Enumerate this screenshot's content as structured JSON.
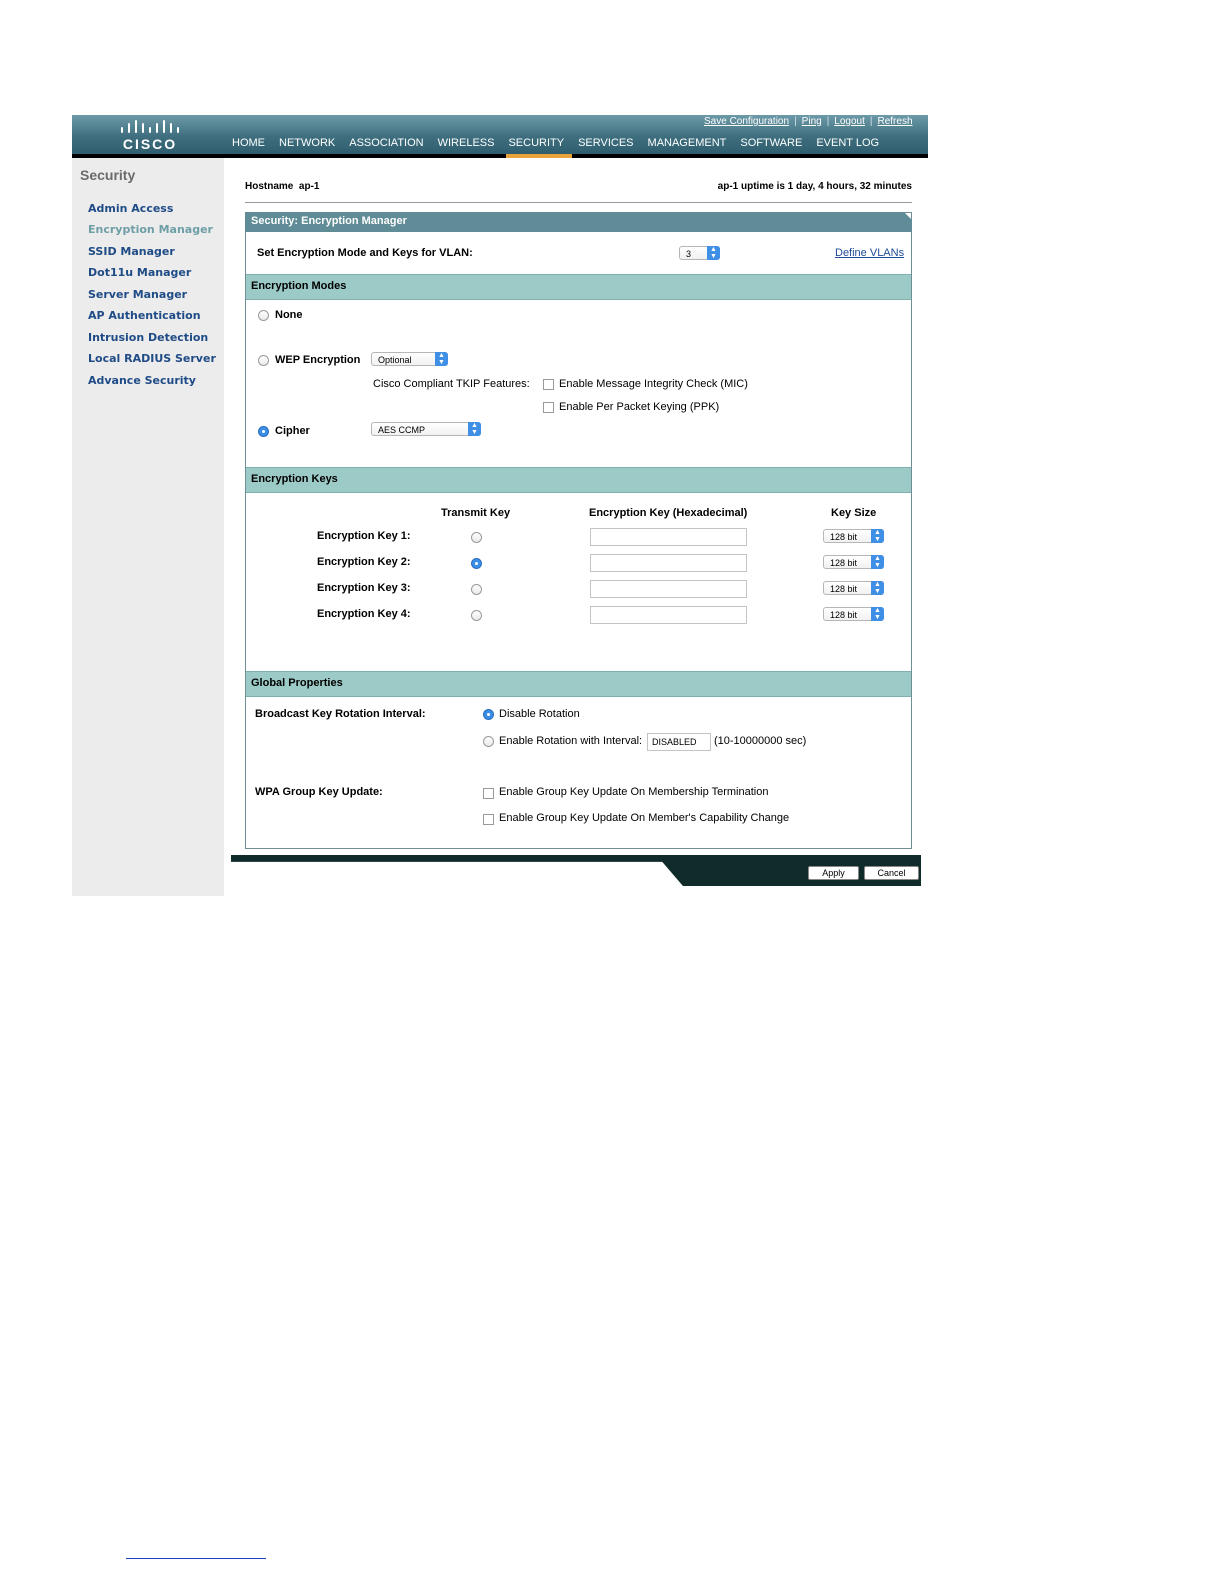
{
  "header": {
    "logo_text": "CISCO",
    "top_links": [
      "Save Configuration",
      "Ping",
      "Logout",
      "Refresh"
    ],
    "nav": [
      "HOME",
      "NETWORK",
      "ASSOCIATION",
      "WIRELESS",
      "SECURITY",
      "SERVICES",
      "MANAGEMENT",
      "SOFTWARE",
      "EVENT LOG"
    ],
    "active_nav": "SECURITY"
  },
  "sidebar": {
    "title": "Security",
    "items": [
      "Admin Access",
      "Encryption Manager",
      "SSID Manager",
      "Dot11u Manager",
      "Server Manager",
      "AP Authentication",
      "Intrusion Detection",
      "Local RADIUS Server",
      "Advance Security"
    ],
    "current": "Encryption Manager"
  },
  "status": {
    "hostname": "Hostname  ap-1",
    "uptime": "ap-1 uptime is 1 day, 4 hours, 32 minutes"
  },
  "panel": {
    "title": "Security: Encryption Manager",
    "vlan_label": "Set Encryption Mode and Keys for VLAN:",
    "vlan_value": "3",
    "define_vlans": "Define VLANs"
  },
  "modes": {
    "title": "Encryption Modes",
    "none": "None",
    "wep": "WEP Encryption",
    "wep_option": "Optional",
    "tkip_label": "Cisco Compliant TKIP Features:",
    "mic": "Enable Message Integrity Check (MIC)",
    "ppk": "Enable Per Packet Keying (PPK)",
    "cipher": "Cipher",
    "cipher_option": "AES CCMP",
    "selected": "Cipher"
  },
  "keys": {
    "title": "Encryption Keys",
    "col_transmit": "Transmit Key",
    "col_key": "Encryption Key (Hexadecimal)",
    "col_size": "Key Size",
    "rows": [
      {
        "label": "Encryption Key 1:",
        "size": "128 bit",
        "transmit": false
      },
      {
        "label": "Encryption Key 2:",
        "size": "128 bit",
        "transmit": true
      },
      {
        "label": "Encryption Key 3:",
        "size": "128 bit",
        "transmit": false
      },
      {
        "label": "Encryption Key 4:",
        "size": "128 bit",
        "transmit": false
      }
    ]
  },
  "global": {
    "title": "Global Properties",
    "broadcast_label": "Broadcast Key Rotation Interval:",
    "disable_rotation": "Disable Rotation",
    "enable_rotation": "Enable Rotation with Interval:",
    "interval_value": "DISABLED",
    "interval_range": "(10-10000000 sec)",
    "wpa_label": "WPA Group Key Update:",
    "membership": "Enable Group Key Update On Membership Termination",
    "capability": "Enable Group Key Update On Member's Capability Change"
  },
  "footer": {
    "apply": "Apply",
    "cancel": "Cancel"
  }
}
